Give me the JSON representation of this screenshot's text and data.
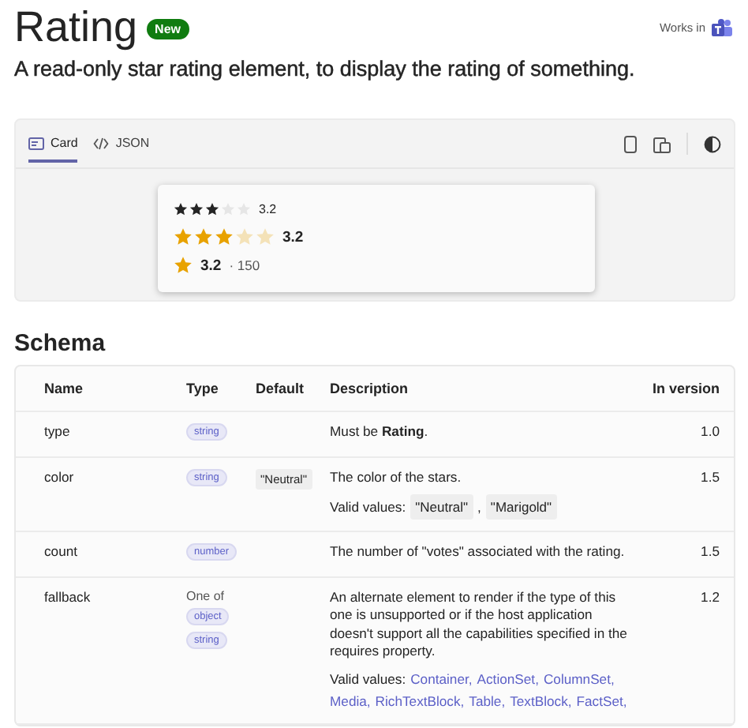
{
  "header": {
    "title": "Rating",
    "badge": "New",
    "works_in": "Works in"
  },
  "subtitle": "A read-only star rating element, to display the rating of something.",
  "preview": {
    "tabs": [
      {
        "label": "Card",
        "kind": "card",
        "selected": true
      },
      {
        "label": "JSON",
        "kind": "code",
        "selected": false
      }
    ],
    "ratings": [
      {
        "kind": "small",
        "color": "#242424",
        "stars": 3,
        "value": "3.2"
      },
      {
        "kind": "medium",
        "color": "#e8a200",
        "stars": 3,
        "value": "3.2"
      },
      {
        "kind": "compact",
        "color": "#e8a200",
        "value": "3.2",
        "count": "· 150"
      }
    ]
  },
  "schema": {
    "title": "Schema",
    "columns": [
      "Name",
      "Type",
      "Default",
      "Description",
      "In version"
    ],
    "rows": [
      {
        "name": "type",
        "type_prefix": null,
        "types": [
          "string"
        ],
        "default": null,
        "description": "Must be **Rating**.",
        "version": "1.0"
      },
      {
        "name": "color",
        "type_prefix": null,
        "types": [
          "string"
        ],
        "default": "\"Neutral\"",
        "description": "The color of the stars.",
        "valid_values": {
          "label": "Valid values:",
          "kind": "code",
          "items": [
            "\"Neutral\"",
            "\"Marigold\""
          ],
          "separator": ","
        },
        "version": "1.5"
      },
      {
        "name": "count",
        "type_prefix": null,
        "types": [
          "number"
        ],
        "default": null,
        "description": "The number of \"votes\" associated with the rating.",
        "version": "1.5"
      },
      {
        "name": "fallback",
        "type_prefix": "One of",
        "types": [
          "object",
          "string"
        ],
        "default": null,
        "description": "An alternate element to render if the type of this one is unsupported or if the host application doesn't support all the capabilities specified in the requires property.",
        "valid_values": {
          "label": "Valid values:",
          "kind": "link",
          "items": [
            "Container,",
            "ActionSet,",
            "ColumnSet,",
            "Media,",
            "RichTextBlock,",
            "Table,",
            "TextBlock,",
            "FactSet,"
          ]
        },
        "version": "1.2"
      }
    ]
  }
}
